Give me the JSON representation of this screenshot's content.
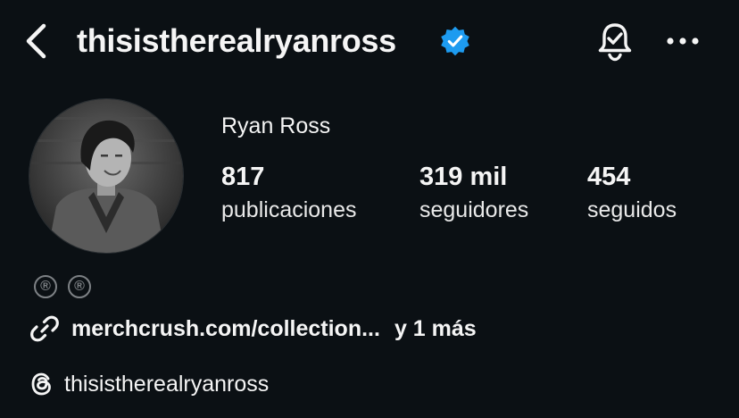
{
  "header": {
    "username": "thisistherealryanross",
    "verified": true,
    "icons": {
      "back": "chevron-left-icon",
      "verified": "verified-badge-icon",
      "notifications": "bell-check-icon",
      "more": "more-horizontal-icon"
    }
  },
  "profile": {
    "display_name": "Ryan Ross",
    "stats": [
      {
        "value": "817",
        "label": "publicaciones"
      },
      {
        "value": "319 mil",
        "label": "seguidores"
      },
      {
        "value": "454",
        "label": "seguidos"
      }
    ],
    "badges": [
      "®",
      "®"
    ],
    "link": {
      "text": "merchcrush.com/collection...",
      "more": "y 1 más"
    },
    "threads": {
      "handle": "thisistherealryanross"
    }
  },
  "colors": {
    "background": "#0b1014",
    "text": "#f5f5f5",
    "verified_blue": "#1d9bf0",
    "muted": "#7d8185"
  }
}
